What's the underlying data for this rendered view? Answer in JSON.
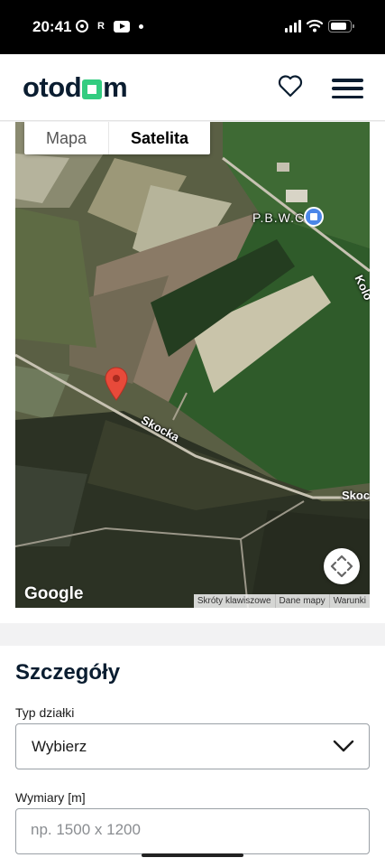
{
  "status_bar": {
    "time": "20:41",
    "indicator_letter": "R",
    "icons": [
      "chrome-icon",
      "r-icon",
      "youtube-icon",
      "dot-icon",
      "signal-icon",
      "wifi-icon",
      "battery-icon"
    ]
  },
  "header": {
    "logo_part1": "otod",
    "logo_part2": "m",
    "icons": [
      "heart-icon",
      "menu-icon"
    ],
    "brand_color": "#33cc80"
  },
  "map": {
    "type_tabs": [
      {
        "label": "Mapa",
        "selected": false
      },
      {
        "label": "Satelita",
        "selected": true
      }
    ],
    "road_labels": [
      "Skocka",
      "Skoc",
      "Kolo"
    ],
    "poi_label": "P.B.W.C.",
    "google_logo": "Google",
    "attributions": [
      "Skróty klawiszowe",
      "Dane mapy",
      "Warunki"
    ],
    "icons": [
      "location-pin-icon",
      "fullscreen-icon",
      "poi-icon"
    ]
  },
  "details": {
    "title": "Szczegóły",
    "plot_type_label": "Typ działki",
    "plot_type_value": "Wybierz",
    "dimensions_label": "Wymiary [m]",
    "dimensions_placeholder": "np. 1500 x 1200",
    "icons": [
      "chevron-down-icon"
    ]
  }
}
